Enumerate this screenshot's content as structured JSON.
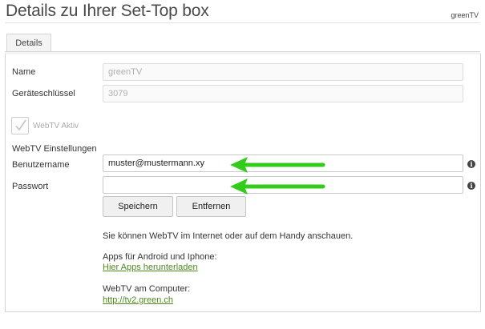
{
  "header": {
    "title": "Details zu Ihrer Set-Top box",
    "brand": "greenTV"
  },
  "tabs": [
    {
      "label": "Details"
    }
  ],
  "form": {
    "name_label": "Name",
    "name_value": "greenTV",
    "key_label": "Geräteschlüssel",
    "key_value": "3079",
    "webtv_active_label": "WebTV Aktiv",
    "webtv_active_checked": true,
    "webtv_settings_label": "WebTV Einstellungen",
    "username_label": "Benutzername",
    "username_value": "muster@mustermann.xy",
    "password_label": "Passwort",
    "password_value": "",
    "save_label": "Speichern",
    "remove_label": "Entfernen"
  },
  "info": {
    "watch_text": "Sie können WebTV im Internet oder auf dem Handy anschauen.",
    "apps_text": "Apps für Android und Iphone:",
    "apps_link": "Hier Apps herunterladen",
    "computer_text": "WebTV am Computer:",
    "computer_link": "http://tv2.green.ch"
  },
  "colors": {
    "arrow": "#33cc1a",
    "link": "#4e8a1e"
  },
  "icons": {
    "info": "info-circle-icon",
    "check": "checkmark-icon",
    "arrow": "arrow-left-icon"
  }
}
